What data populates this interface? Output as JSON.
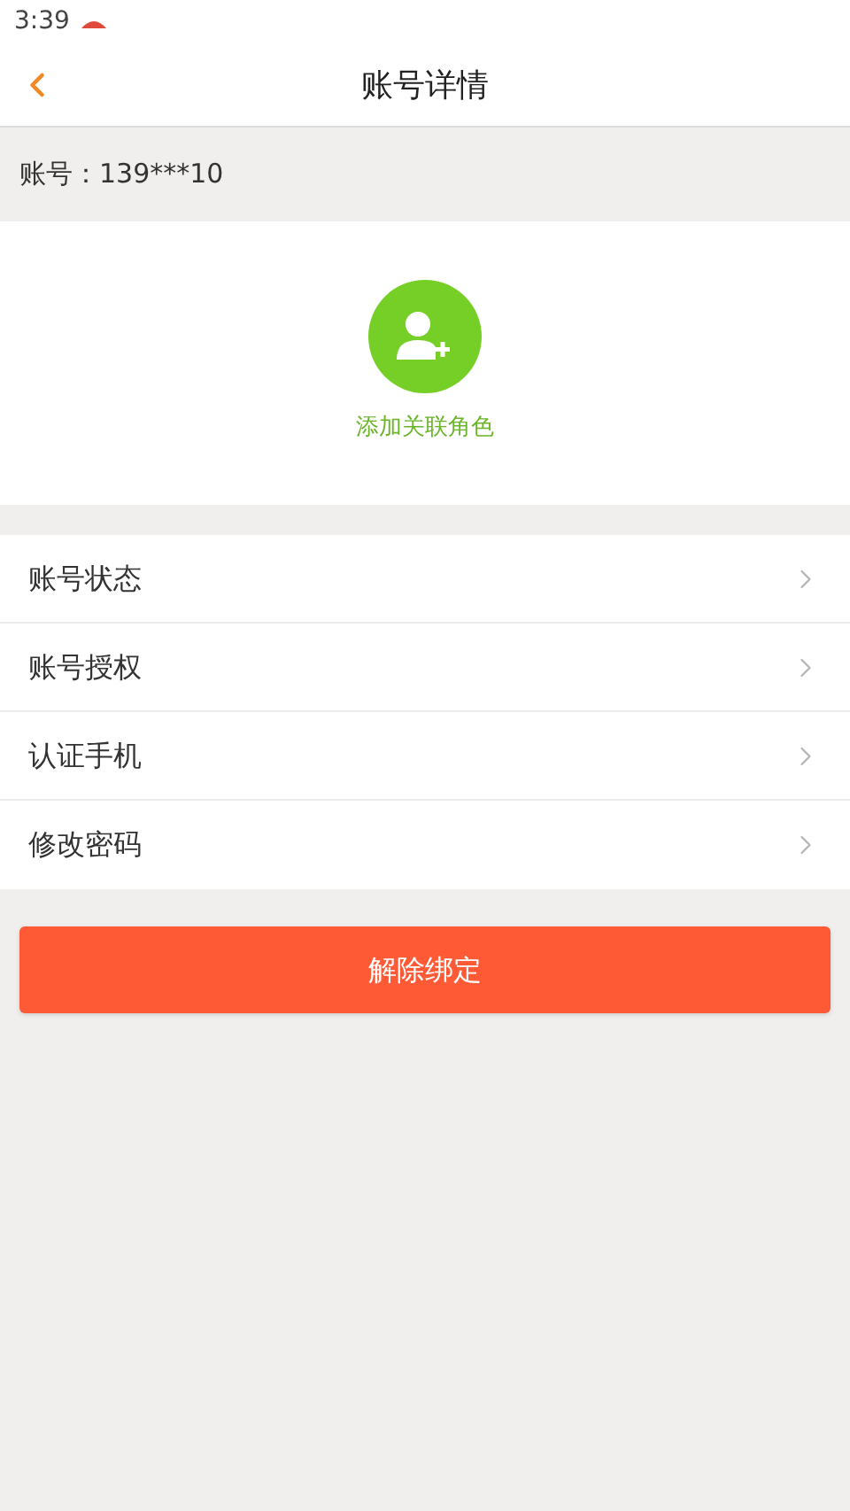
{
  "status_bar": {
    "time": "3:39"
  },
  "header": {
    "title": "账号详情"
  },
  "account": {
    "label": "账号：139***10"
  },
  "add_role": {
    "label": "添加关联角色"
  },
  "menu_items": [
    {
      "label": "账号状态"
    },
    {
      "label": "账号授权"
    },
    {
      "label": "认证手机"
    },
    {
      "label": "修改密码"
    }
  ],
  "unbind_button": {
    "label": "解除绑定"
  }
}
